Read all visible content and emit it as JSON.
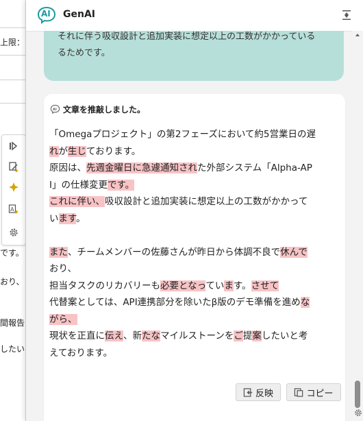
{
  "background": {
    "snippets": [
      "上限：",
      "です。",
      "おり、",
      "間報告の",
      "したい"
    ]
  },
  "toolbar": {
    "buttons": [
      {
        "icon": "insert-icon"
      },
      {
        "icon": "edit-sparkle-icon"
      },
      {
        "icon": "sparkle-icon"
      },
      {
        "icon": "translate-icon"
      },
      {
        "icon": "gear-icon"
      }
    ]
  },
  "panel": {
    "title": "GenAI",
    "logo_text": "AI",
    "prev_message": {
      "lines": [
        "それに伴う吸収設計と追加実装に想定以上の工数がかかっている",
        "るためです。"
      ]
    },
    "response": {
      "header": "文章を推敲しました。",
      "lines": [
        [
          {
            "t": "「Omegaプロジェクト」の第2フェーズにおいて約5営業日の遅"
          }
        ],
        [
          {
            "t": "れ",
            "h": true
          },
          {
            "t": "が"
          },
          {
            "t": "生じ",
            "h": true
          },
          {
            "t": "ております。"
          }
        ],
        [
          {
            "t": "原因は、"
          },
          {
            "t": "先週金曜日に急遽通知され",
            "h": true
          },
          {
            "t": "た外部システム「Alpha-AP"
          }
        ],
        [
          {
            "t": "I」の仕様変更"
          },
          {
            "t": "です。",
            "h": true
          }
        ],
        [
          {
            "t": "これに伴い、",
            "h": true
          },
          {
            "t": "吸収設計と追加実装に想定以上の工数がかかって"
          }
        ],
        [
          {
            "t": "い"
          },
          {
            "t": "ます",
            "h": true
          },
          {
            "t": "。"
          }
        ],
        [],
        [
          {
            "t": "また",
            "h": true
          },
          {
            "t": "、チームメンバーの佐藤さんが昨日から体調不良で"
          },
          {
            "t": "休んで",
            "h": true
          }
        ],
        [
          {
            "t": "おり、"
          }
        ],
        [
          {
            "t": "担当タスクのリカバリーも"
          },
          {
            "t": "必要となっ",
            "h": true
          },
          {
            "t": "てい"
          },
          {
            "t": "ま",
            "h": true
          },
          {
            "t": "す。"
          },
          {
            "t": "させて",
            "h": true
          }
        ],
        [
          {
            "t": "代替案としては、API連携部分を除いたβ版のデモ準備を進め"
          },
          {
            "t": "な",
            "h": true
          }
        ],
        [
          {
            "t": "がら、",
            "h": true
          }
        ],
        [
          {
            "t": "現状を正直に"
          },
          {
            "t": "伝え",
            "h": true
          },
          {
            "t": "、新"
          },
          {
            "t": "たな",
            "h": true
          },
          {
            "t": "マイルストーンを"
          },
          {
            "t": "ご",
            "h": true
          },
          {
            "t": "提"
          },
          {
            "t": "案",
            "h": true
          },
          {
            "t": "したいと考"
          }
        ],
        [
          {
            "t": "えております。"
          }
        ]
      ],
      "reflect_label": "反映",
      "copy_label": "コピー"
    }
  },
  "colors": {
    "accent_teal": "#b7dfd9",
    "highlight": "#f7c3c5",
    "logo_teal": "#1a9aa0"
  }
}
